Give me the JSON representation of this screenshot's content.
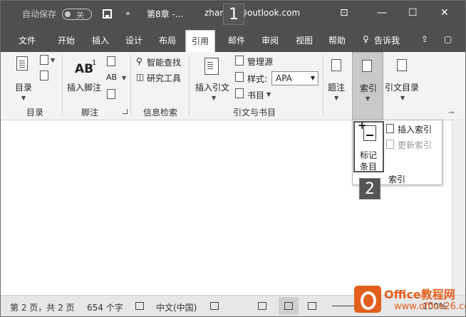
{
  "titlebar": {
    "autosave_label": "自动保存",
    "autosave_state": "关",
    "more": "»",
    "document_title": "第8章 -...",
    "user_email": "zhan      64@outlook.com"
  },
  "step_badges": [
    "1",
    "2"
  ],
  "tabs": [
    "文件",
    "开始",
    "插入",
    "设计",
    "布局",
    "引用",
    "邮件",
    "审阅",
    "视图",
    "帮助",
    "告诉我"
  ],
  "active_tab": "引用",
  "ribbon": {
    "toc_label": "目录",
    "toc_group": "目录",
    "footnote_big": "AB",
    "footnote_sup": "1",
    "insert_footnote": "插入脚注",
    "footnote_small": "AB",
    "footnote_group": "脚注",
    "smart_lookup": "智能查找",
    "researcher": "研究工具",
    "research_group": "信息检索",
    "insert_citation": "插入引文",
    "manage_sources": "管理源",
    "style_label": "样式:",
    "style_value": "APA",
    "bibliography": "书目",
    "citations_group": "引文与书目",
    "captions": "题注",
    "index": "索引",
    "table_of_authorities": "引文目录"
  },
  "index_dropdown": {
    "mark_entry_line1": "标记",
    "mark_entry_line2": "条目",
    "insert_index": "插入索引",
    "update_index": "更新索引",
    "group_caption": "索引"
  },
  "statusbar": {
    "page": "第 2 页，共 2 页",
    "words": "654 个字",
    "language": "中文(中国)"
  },
  "watermark": {
    "brand": "Office教程网",
    "url": "www.office26.com",
    "zoom_fragment": "100%"
  }
}
